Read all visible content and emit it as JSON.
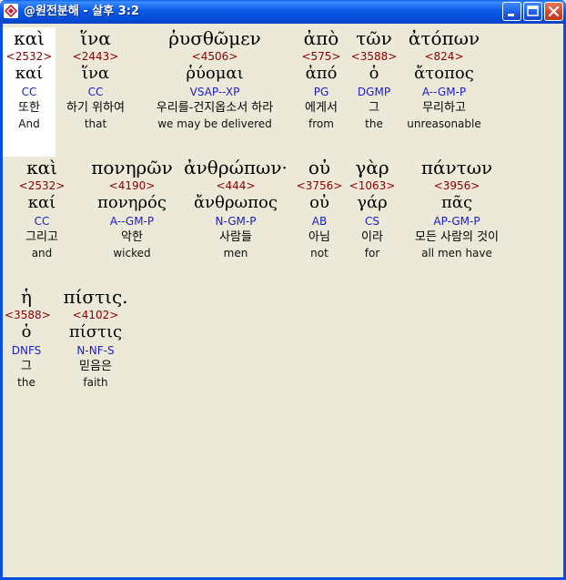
{
  "window": {
    "title": "@원전분해 - 살후 3:2",
    "colors": {
      "titlebar": "#0a5ae8",
      "background": "#ece9d8",
      "strong": "#8b0000",
      "parsing": "#1c1cd0"
    },
    "buttons": {
      "minimize_icon": "minimize-icon",
      "maximize_icon": "maximize-icon",
      "close_icon": "close-icon"
    }
  },
  "words": [
    {
      "greek": "καὶ",
      "strong": "<2532>",
      "lemma": "καί",
      "parsing": "CC",
      "korean": "또한",
      "english": "And"
    },
    {
      "greek": "ἵνα",
      "strong": "<2443>",
      "lemma": "ἵνα",
      "parsing": "CC",
      "korean": "하기 위하여",
      "english": "that"
    },
    {
      "greek": "ῥυσθῶμεν",
      "strong": "<4506>",
      "lemma": "ῥύομαι",
      "parsing": "VSAP--XP",
      "korean": "우리를-건지옵소서 하라",
      "english": "we may be delivered"
    },
    {
      "greek": "ἀπὸ",
      "strong": "<575>",
      "lemma": "ἀπό",
      "parsing": "PG",
      "korean": "에게서",
      "english": "from"
    },
    {
      "greek": "τῶν",
      "strong": "<3588>",
      "lemma": "ὁ",
      "parsing": "DGMP",
      "korean": "그",
      "english": "the"
    },
    {
      "greek": "ἀτόπων",
      "strong": "<824>",
      "lemma": "ἄτοπος",
      "parsing": "A--GM-P",
      "korean": "무리하고",
      "english": "unreasonable"
    },
    {
      "greek": "καὶ",
      "strong": "<2532>",
      "lemma": "καί",
      "parsing": "CC",
      "korean": "그리고",
      "english": "and"
    },
    {
      "greek": "πονηρῶν",
      "strong": "<4190>",
      "lemma": "πονηρός",
      "parsing": "A--GM-P",
      "korean": "악한",
      "english": "wicked"
    },
    {
      "greek": "ἀνθρώπων·",
      "strong": "<444>",
      "lemma": "ἄνθρωπος",
      "parsing": "N-GM-P",
      "korean": "사람들",
      "english": "men"
    },
    {
      "greek": "οὐ",
      "strong": "<3756>",
      "lemma": "οὐ",
      "parsing": "AB",
      "korean": "아님",
      "english": "not"
    },
    {
      "greek": "γὰρ",
      "strong": "<1063>",
      "lemma": "γάρ",
      "parsing": "CS",
      "korean": "이라",
      "english": "for"
    },
    {
      "greek": "πάντων",
      "strong": "<3956>",
      "lemma": "πᾶς",
      "parsing": "AP-GM-P",
      "korean": "모든 사람의 것이",
      "english": "all men have"
    },
    {
      "greek": "ἡ",
      "strong": "<3588>",
      "lemma": "ὁ",
      "parsing": "DNFS",
      "korean": "그",
      "english": "the"
    },
    {
      "greek": "πίστις.",
      "strong": "<4102>",
      "lemma": "πίστις",
      "parsing": "N-NF-S",
      "korean": "믿음은",
      "english": "faith"
    }
  ]
}
